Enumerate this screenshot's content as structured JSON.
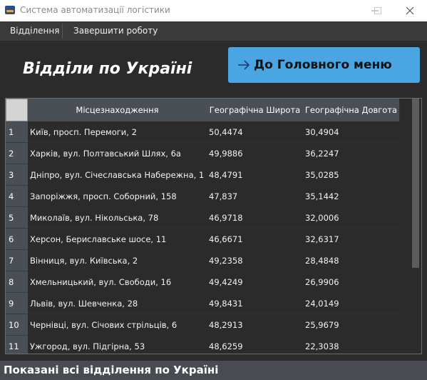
{
  "window": {
    "title": "Система автоматизації логістики",
    "minimize_icon": "minimize-icon",
    "maximize_icon": "maximize-icon",
    "close_icon": "close-icon"
  },
  "menu": {
    "items": [
      "Відділення",
      "Завершити роботу"
    ]
  },
  "page": {
    "heading": "Відділи по Україні",
    "main_menu_button": "До Головного меню",
    "button_icon": "arrow-right-icon",
    "accent_color": "#4aa6e2"
  },
  "table": {
    "columns": [
      "Місцезнаходження",
      "Географічна Широта",
      "Географічна Довгота"
    ],
    "rows": [
      {
        "n": "1",
        "loc": "Київ, просп. Перемоги, 2",
        "lat": "50,4474",
        "lon": "30,4904"
      },
      {
        "n": "2",
        "loc": "Харків, вул. Полтавський Шлях, 6а",
        "lat": "49,9886",
        "lon": "36,2247"
      },
      {
        "n": "3",
        "loc": "Дніпро, вул. Січеславська Набережна, 1",
        "lat": "48,4791",
        "lon": "35,0285"
      },
      {
        "n": "4",
        "loc": "Запоріжжя, просп. Соборний, 158",
        "lat": "47,837",
        "lon": "35,1442"
      },
      {
        "n": "5",
        "loc": "Миколаїв, вул. Нікольська, 78",
        "lat": "46,9718",
        "lon": "32,0006"
      },
      {
        "n": "6",
        "loc": "Херсон, Бериславське шосе, 11",
        "lat": "46,6671",
        "lon": "32,6317"
      },
      {
        "n": "7",
        "loc": "Вінниця, вул. Київська, 2",
        "lat": "49,2358",
        "lon": "28,4848"
      },
      {
        "n": "8",
        "loc": "Хмельницький, вул. Свободи, 16",
        "lat": "49,4249",
        "lon": "26,9906"
      },
      {
        "n": "9",
        "loc": "Львів, вул. Шевченка, 28",
        "lat": "49,8431",
        "lon": "24,0149"
      },
      {
        "n": "10",
        "loc": "Чернівці, вул. Січових стрільців, 6",
        "lat": "48,2913",
        "lon": "25,9679"
      },
      {
        "n": "11",
        "loc": "Ужгород, вул. Підгірна, 53",
        "lat": "48,6259",
        "lon": "22,3038"
      }
    ]
  },
  "status": {
    "text": "Показані всі відділення по Україні"
  }
}
